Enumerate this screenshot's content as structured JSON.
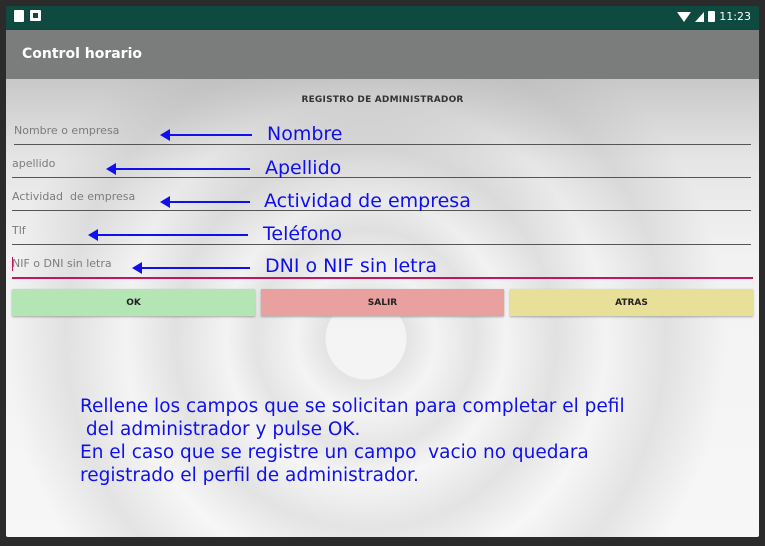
{
  "statusbar": {
    "time": "11:23"
  },
  "appbar": {
    "title": "Control horario"
  },
  "form": {
    "section_title": "REGISTRO DE ADMINISTRADOR",
    "fields": [
      {
        "placeholder": "Nombre o empresa",
        "value": ""
      },
      {
        "placeholder": "apellido",
        "value": ""
      },
      {
        "placeholder": "Actividad  de empresa",
        "value": ""
      },
      {
        "placeholder": "Tlf",
        "value": ""
      },
      {
        "placeholder": "NIF o DNI sin letra",
        "value": ""
      }
    ]
  },
  "annotations": [
    "Nombre",
    "Apellido",
    "Actividad de empresa",
    "Teléfono",
    "DNI o NIF sin letra"
  ],
  "buttons": {
    "ok": "OK",
    "salir": "SALIR",
    "atras": "ATRAS"
  },
  "instructions": {
    "line1": "Rellene los campos que se solicitan para completar el pefil",
    "line2": " del administrador y pulse OK.",
    "line3": "En el caso que se registre un campo  vacio no quedara",
    "line4": "registrado el perfil de administrador."
  },
  "colors": {
    "statusbar": "#0f4a40",
    "appbar": "#7b7d7c",
    "annotation": "#1010ee",
    "ok": "#b3e5b5",
    "salir": "#e8a19f",
    "atras": "#e8df98",
    "focus_underline": "#c2185b"
  },
  "icons": [
    "notification-icon",
    "notification-icon-2",
    "wifi-icon",
    "signal-icon",
    "battery-icon"
  ]
}
